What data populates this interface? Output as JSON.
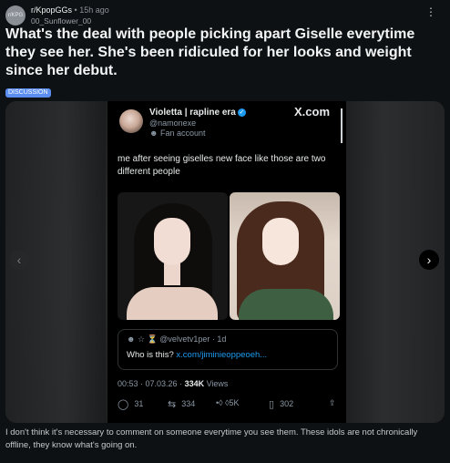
{
  "header": {
    "avatar_text": "r/KPG",
    "subreddit": "r/KpopGGs",
    "separator": "•",
    "time_ago": "15h ago",
    "username": "00_Sunflower_00",
    "menu_icon": "more-dots-icon"
  },
  "post": {
    "title": "What's the deal with people picking apart Giselle everytime they see her. She's been ridiculed for her looks and weight since her debut.",
    "flair": "DISCUSSION",
    "body": "I don't think it's necessary to comment on someone everytime you see them. These idols are not chronically offline, they know what's going on."
  },
  "media": {
    "prev_icon": "‹",
    "next_icon": "›"
  },
  "tweet": {
    "display_name": "Violetta | rapline era",
    "verified_icon": "✓",
    "handle": "@namonexe",
    "fan_label": "Fan account",
    "fan_icon": "fan-badge-icon",
    "source_logo": "X.com",
    "text": "me after seeing giselles new face like those are two different people",
    "quote": {
      "header": "☆ ⏳ @velvetv1per · 1d",
      "text": "Who is this? ",
      "link": "x.com/jiminieoppeoeh..."
    },
    "time": "00:53 · 07.03.26 · ",
    "views_count": "334K",
    "views_label": " Views",
    "actions": {
      "replies": "31",
      "reposts": "334",
      "likes": "•◊ ◊5K",
      "bookmarks": "302"
    }
  }
}
